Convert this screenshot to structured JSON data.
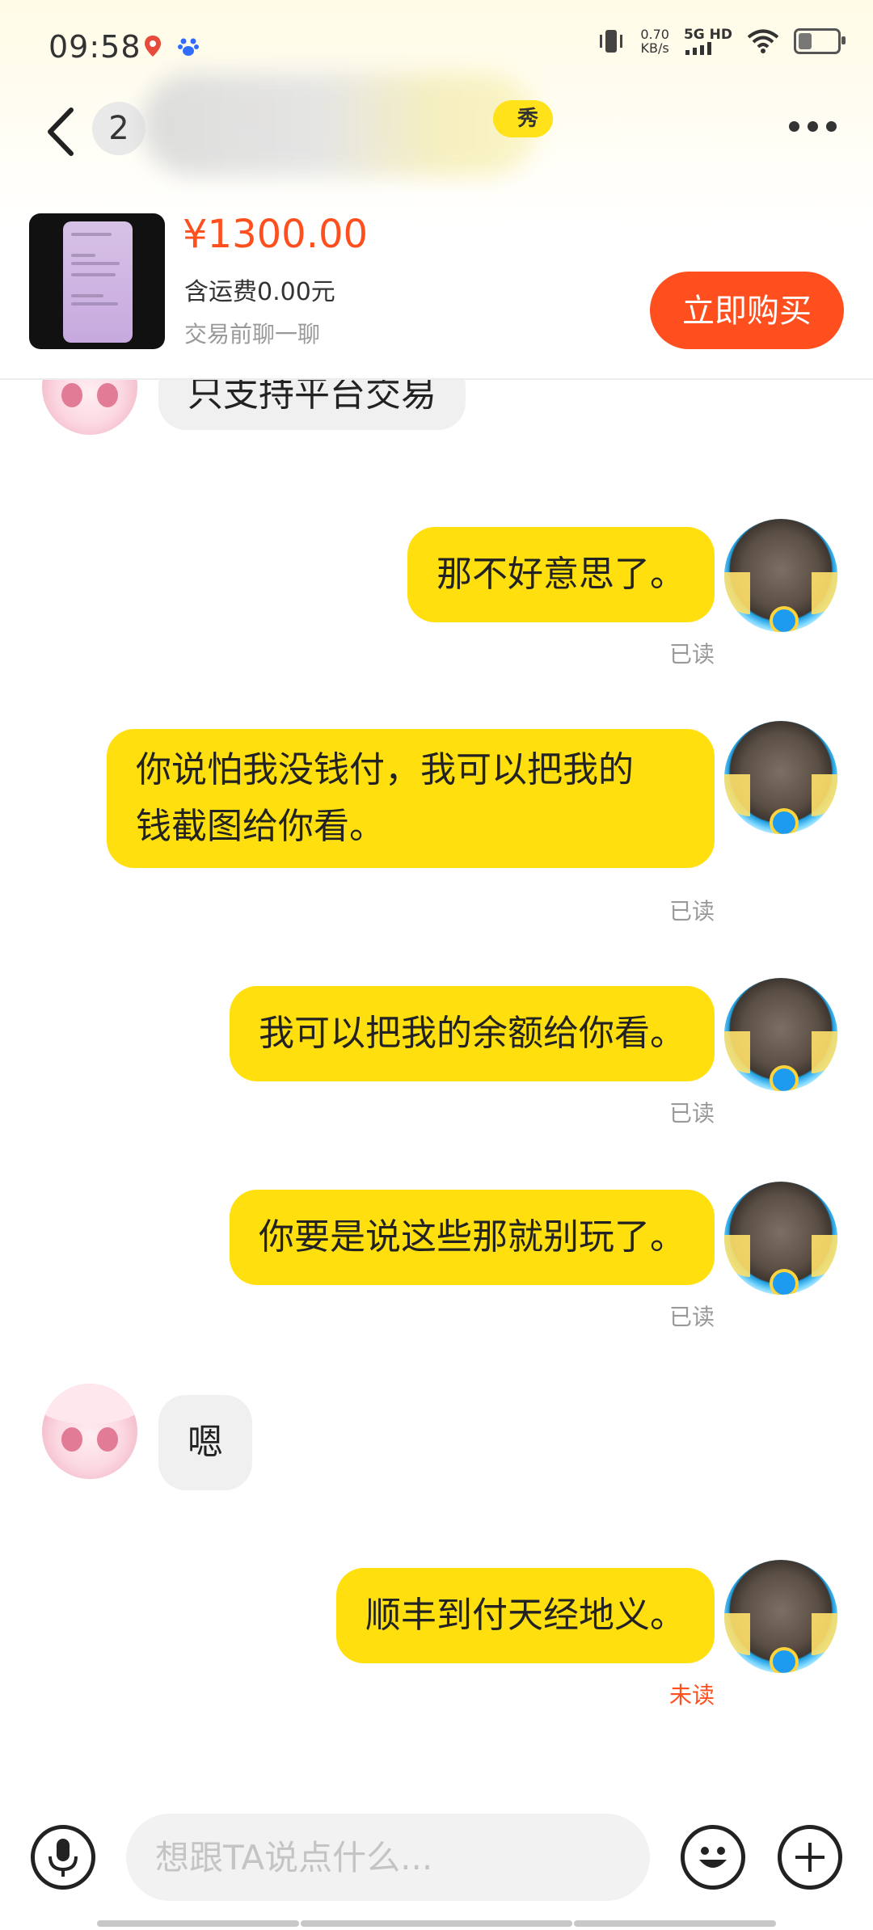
{
  "status_bar": {
    "time": "09:58",
    "net_speed_value": "0.70",
    "net_speed_unit": "KB/s",
    "network": "5G HD",
    "battery_level": 0.35
  },
  "header": {
    "unread_count": "2",
    "badge_text": "秀",
    "product": {
      "price": "¥1300.00",
      "shipping": "含运费0.00元",
      "hint": "交易前聊一聊",
      "buy_label": "立即购买"
    }
  },
  "messages": [
    {
      "from": "them",
      "text": "只支持平台交易"
    },
    {
      "from": "me",
      "text": "那不好意思了。",
      "status": "已读"
    },
    {
      "from": "me",
      "text": "你说怕我没钱付，我可以把我的钱截图给你看。",
      "line1": "你说怕我没钱付，我可以把我的",
      "line2": "钱截图给你看。",
      "status": "已读"
    },
    {
      "from": "me",
      "text": "我可以把我的余额给你看。",
      "status": "已读"
    },
    {
      "from": "me",
      "text": "你要是说这些那就别玩了。",
      "status": "已读"
    },
    {
      "from": "them",
      "text": "嗯"
    },
    {
      "from": "me",
      "text": "顺丰到付天经地义。",
      "status": "未读"
    }
  ],
  "input": {
    "placeholder": "想跟TA说点什么..."
  },
  "colors": {
    "accent": "#ff4f1f",
    "bubble_out": "#ffe00e",
    "badge": "#ffe21a"
  },
  "icons": [
    "back-icon",
    "more-icon",
    "microphone-icon",
    "emoji-icon",
    "plus-icon"
  ]
}
